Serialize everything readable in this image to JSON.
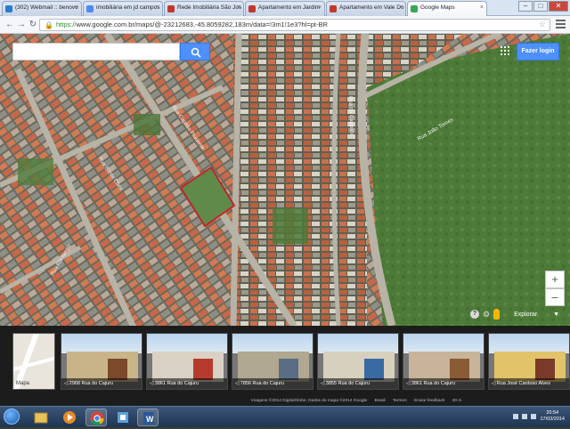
{
  "browser": {
    "tabs": [
      {
        "label": "(302) Webmail :: benovo",
        "favicon_color": "#2a7ad1",
        "active": false
      },
      {
        "label": "imobiliária em jd campos",
        "favicon_color": "#4c8bf5",
        "active": false
      },
      {
        "label": "Rede Imobiliária São Jos",
        "favicon_color": "#c0392b",
        "active": false
      },
      {
        "label": "Apartamento em Jardim",
        "favicon_color": "#c0392b",
        "active": false
      },
      {
        "label": "Apartamento em Vale Do",
        "favicon_color": "#c0392b",
        "active": false
      },
      {
        "label": "Google Maps",
        "favicon_color": "#34a853",
        "active": true
      }
    ],
    "window_buttons": {
      "minimize": "–",
      "maximize": "□",
      "close": "✕"
    },
    "url_scheme": "https://",
    "url_rest": "www.google.com.br/maps/@-23212683,-45.8059282,183m/data=!3m1!1e3?hl=pt-BR"
  },
  "map": {
    "search_placeholder": "",
    "login_label": "Fazer login",
    "zoom_in": "+",
    "zoom_out": "–",
    "explore_label": "Explorar",
    "help_glyph": "?",
    "street_labels": [
      "Rua Capitão Prudente",
      "Rua do Cajueiro",
      "Rua Santa Clara",
      "Rua Rio Negro",
      "Rua João Tornes"
    ]
  },
  "filmstrip": {
    "map_label": "Mapa",
    "photos": [
      {
        "caption": "2968 Rua do Cajuru",
        "wall": "#c9b48a",
        "door": "#7a4a2a"
      },
      {
        "caption": "3861 Rua do Cajuru",
        "wall": "#d9d2c4",
        "door": "#b73a2e"
      },
      {
        "caption": "7856 Rua do Cajuru",
        "wall": "#b0a890",
        "door": "#5a6d84"
      },
      {
        "caption": "3855 Rua do Cajuru",
        "wall": "#d8d0be",
        "door": "#3b6aa3"
      },
      {
        "caption": "3861 Rua do Cajuru",
        "wall": "#c8b49a",
        "door": "#8a5c35"
      },
      {
        "caption": "Rua José Cardoso Alves",
        "wall": "#e1c36a",
        "door": "#7a3a2a"
      }
    ]
  },
  "footer": {
    "items": [
      "Imagens ©2014 DigitalGlobe, Dados do mapa ©2014 Google",
      "Brasil",
      "Termos",
      "Enviar feedback",
      "20 m"
    ]
  },
  "taskbar": {
    "time": "20:54",
    "date": "17/03/2014"
  },
  "colors": {
    "accent": "#4d90fe",
    "vegetation": "#4f7a3a",
    "rooftops": "#c8674a",
    "highlight": "#c0282b"
  }
}
